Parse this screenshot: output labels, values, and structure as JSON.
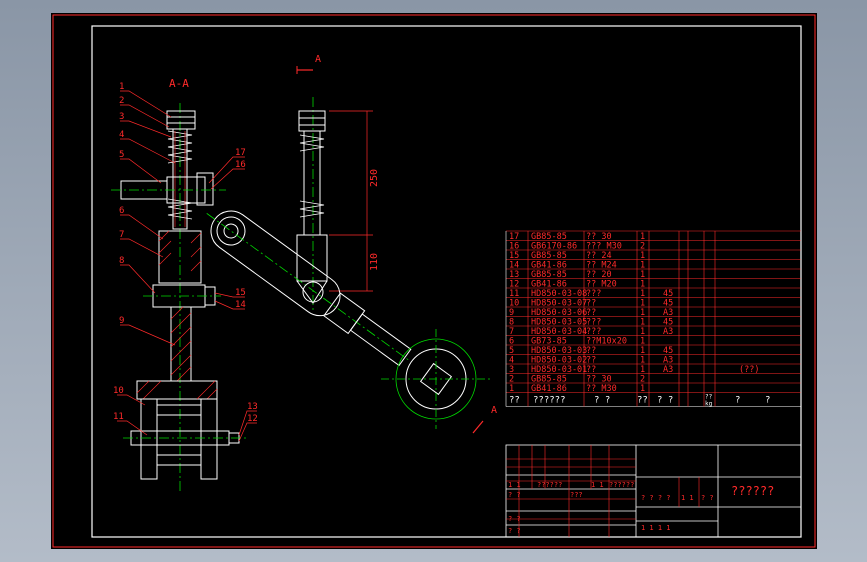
{
  "section_view": {
    "title": "A-A"
  },
  "section_mark": {
    "letter_top": "A",
    "letter_bottom": "A"
  },
  "dimensions": {
    "upper": "250",
    "lower": "110"
  },
  "callouts": [
    "1",
    "2",
    "3",
    "4",
    "5",
    "6",
    "7",
    "8",
    "9",
    "10",
    "11",
    "12",
    "13",
    "14",
    "15",
    "16",
    "17"
  ],
  "bom": {
    "rows": [
      {
        "no": "17",
        "code": "GB85-85",
        "name": "?? 30",
        "qty": "1",
        "material": ""
      },
      {
        "no": "16",
        "code": "GB6170-86",
        "name": "??? M30",
        "qty": "2",
        "material": ""
      },
      {
        "no": "15",
        "code": "GB85-85",
        "name": "?? 24",
        "qty": "1",
        "material": ""
      },
      {
        "no": "14",
        "code": "GB41-86",
        "name": "?? M24",
        "qty": "1",
        "material": ""
      },
      {
        "no": "13",
        "code": "GB85-85",
        "name": "?? 20",
        "qty": "1",
        "material": ""
      },
      {
        "no": "12",
        "code": "GB41-86",
        "name": "?? M20",
        "qty": "1",
        "material": ""
      },
      {
        "no": "11",
        "code": "HD850-03-08",
        "name": "???",
        "qty": "1",
        "material": "45"
      },
      {
        "no": "10",
        "code": "HD850-03-07",
        "name": "??",
        "qty": "1",
        "material": "45"
      },
      {
        "no": "9",
        "code": "HD850-03-06",
        "name": "??",
        "qty": "1",
        "material": "A3"
      },
      {
        "no": "8",
        "code": "HD850-03-05",
        "name": "???",
        "qty": "1",
        "material": "45"
      },
      {
        "no": "7",
        "code": "HD850-03-04",
        "name": "???",
        "qty": "1",
        "material": "A3"
      },
      {
        "no": "6",
        "code": "GB73-85",
        "name": "??M10x20",
        "qty": "1",
        "material": ""
      },
      {
        "no": "5",
        "code": "HD850-03-03",
        "name": "??",
        "qty": "1",
        "material": "45"
      },
      {
        "no": "4",
        "code": "HD850-03-02",
        "name": "??",
        "qty": "1",
        "material": "A3"
      },
      {
        "no": "3",
        "code": "HD850-03-01",
        "name": "??",
        "qty": "1",
        "material": "A3",
        "note": "(??)"
      },
      {
        "no": "2",
        "code": "GB85-85",
        "name": "?? 30",
        "qty": "2",
        "material": ""
      },
      {
        "no": "1",
        "code": "GB41-86",
        "name": "?? M30",
        "qty": "1",
        "material": ""
      }
    ],
    "header": {
      "no": "??",
      "code": "??????",
      "name": "? ?",
      "qty": "??",
      "material": "? ?",
      "unit_top": "??",
      "unit_kg": "kg",
      "remark1": "?",
      "remark2": "?"
    }
  },
  "title_block": {
    "title": "??????",
    "r1": "1 1",
    "r2": "??????",
    "r3": "1 1",
    "r4": "??????",
    "s1": "? ?",
    "s2": "???",
    "s3": "? ?",
    "s4": "? ?",
    "scale_label": "? ? ? ?",
    "scale_1": "1 1",
    "scale_2": "? ?",
    "sheet": "1      1      1      1"
  },
  "colors": {
    "red": "#ff2a2a",
    "green": "#00d800",
    "white": "#ffffff",
    "yellow": "#e6e600",
    "cyan": "#00e0e0",
    "magenta": "#ff55ff"
  }
}
